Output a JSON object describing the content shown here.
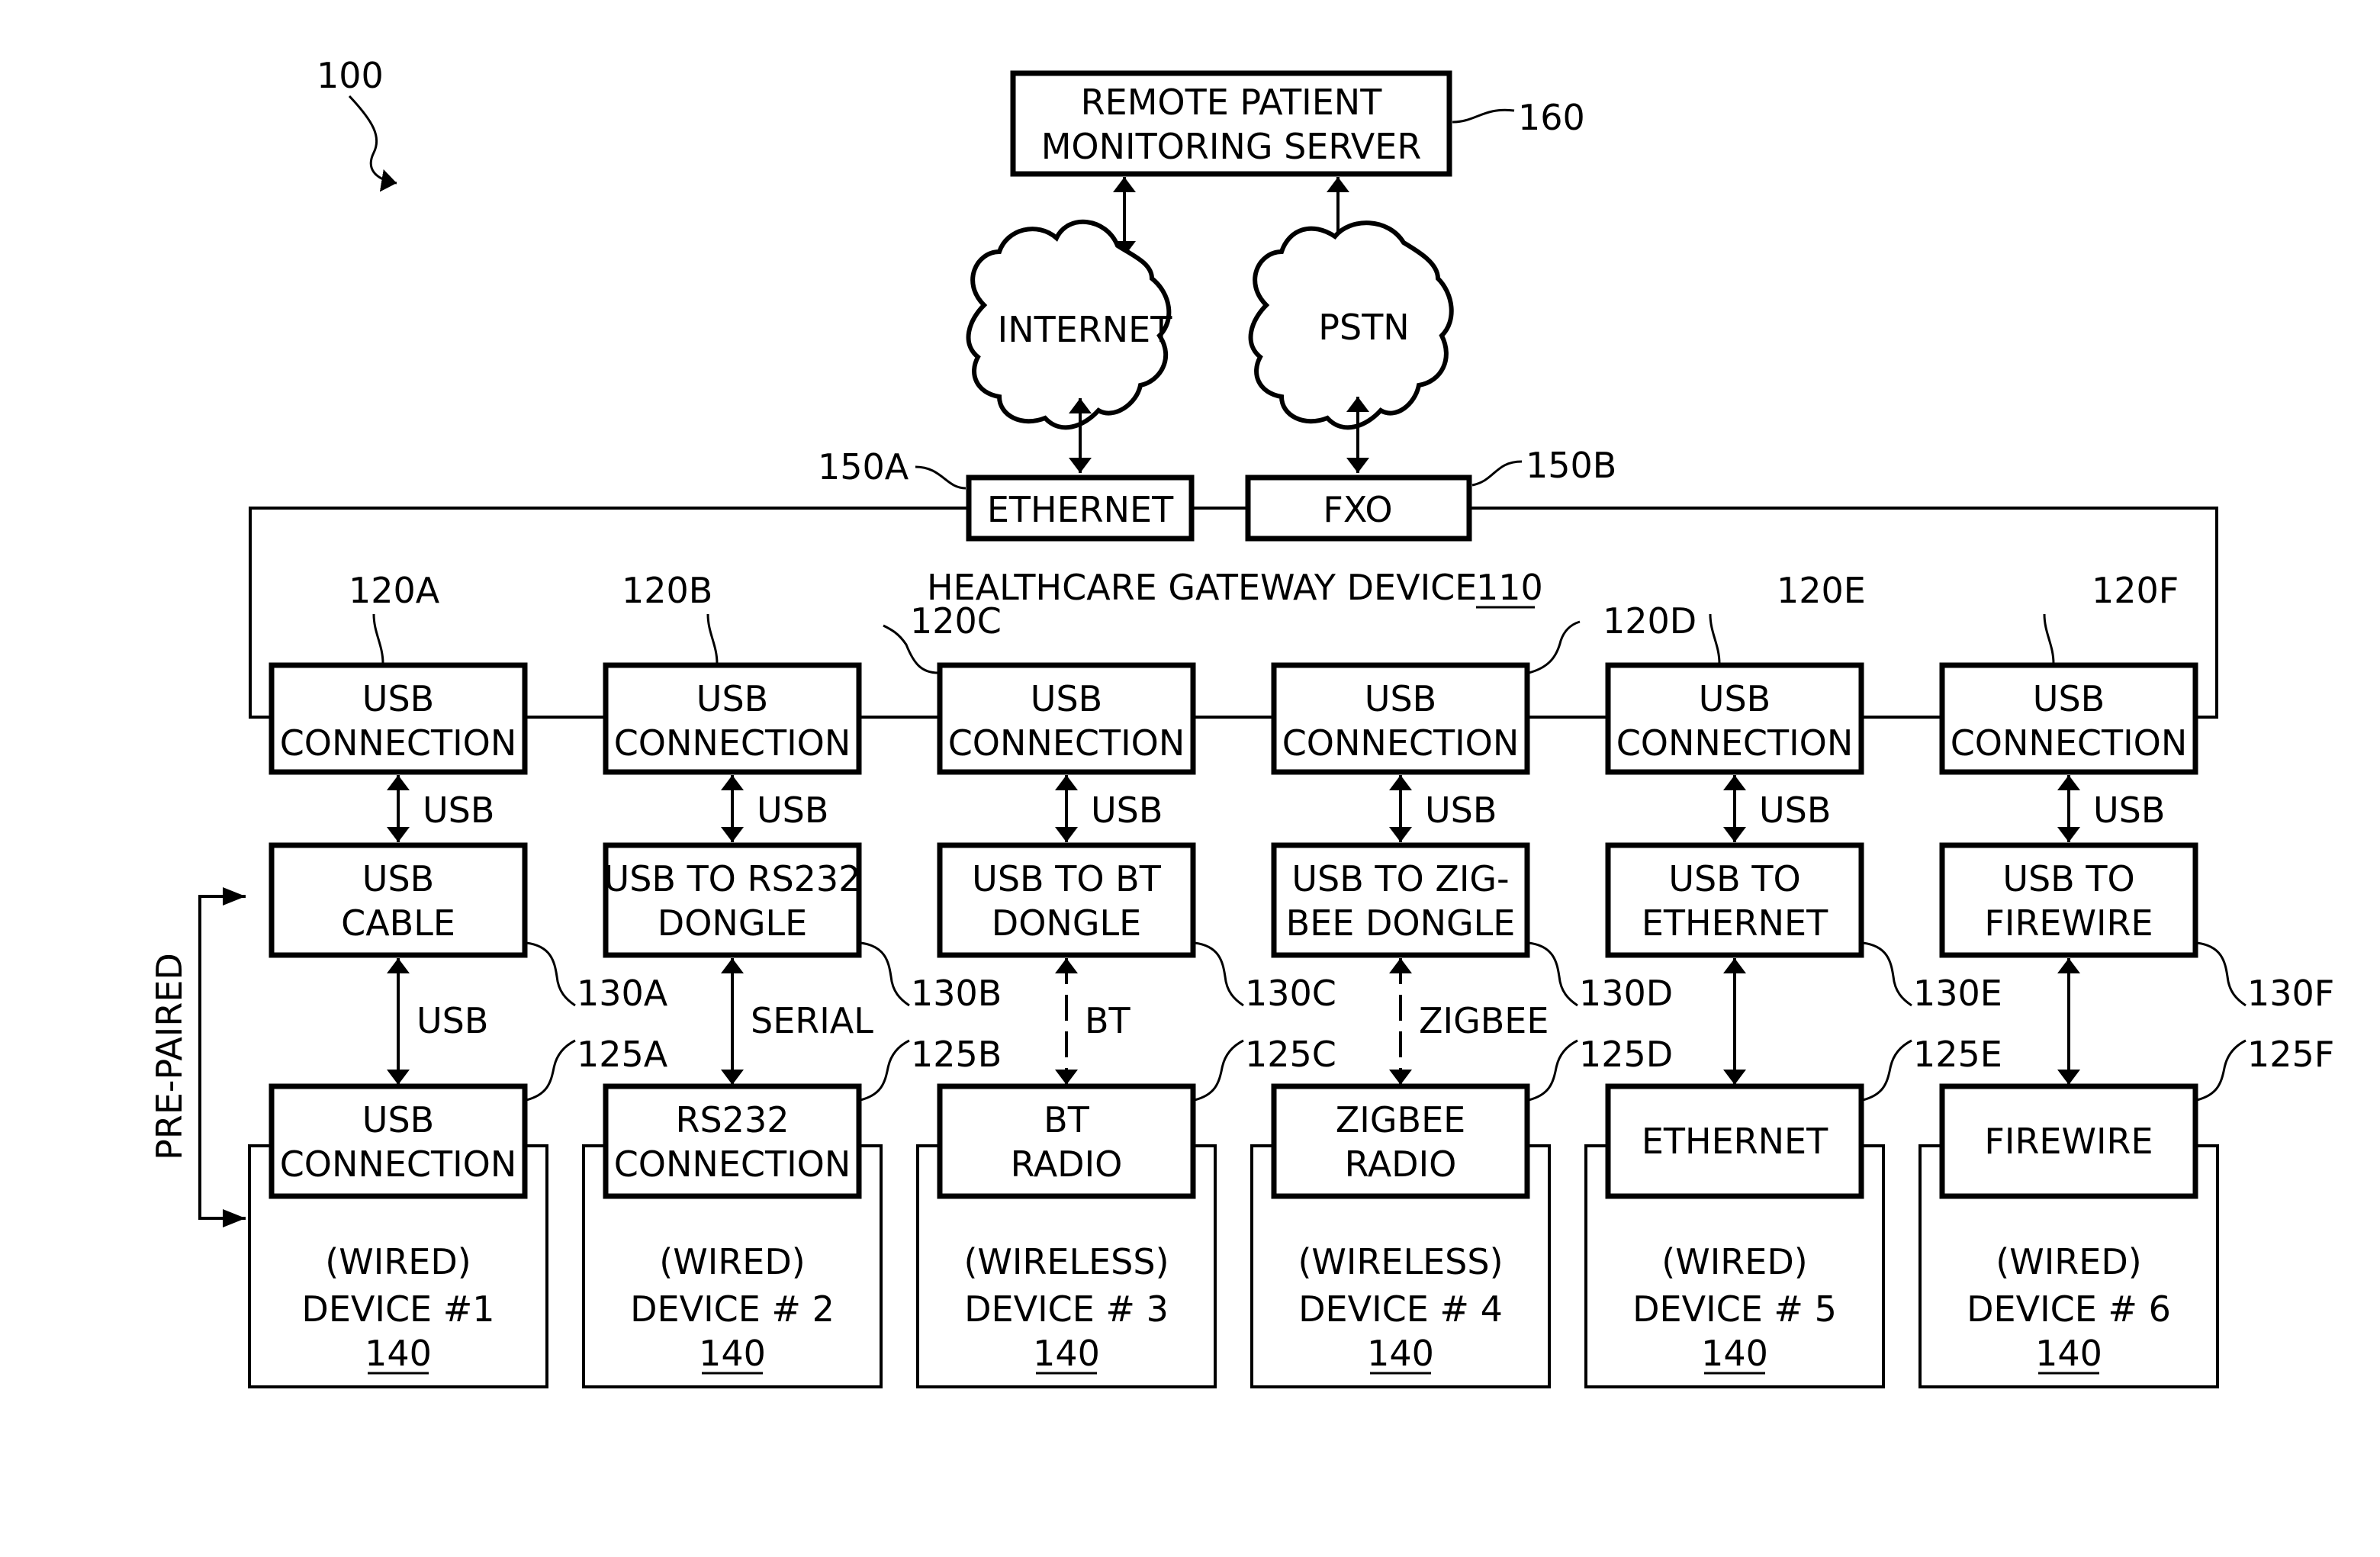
{
  "figure": {
    "ref": "100",
    "colors": {
      "line": "#000000",
      "background": "#ffffff"
    }
  },
  "server": {
    "lines": [
      "REMOTE PATIENT",
      "MONITORING SERVER"
    ],
    "ref": "160"
  },
  "networks": [
    {
      "label": "INTERNET"
    },
    {
      "label": "PSTN"
    }
  ],
  "uplinks": [
    {
      "label": "ETHERNET",
      "ref": "150A"
    },
    {
      "label": "FXO",
      "ref": "150B"
    }
  ],
  "gateway": {
    "title": "HEALTHCARE GATEWAY DEVICE",
    "ref": "110"
  },
  "pre_paired_label": "PRE-PAIRED",
  "columns": [
    {
      "usb_conn": {
        "lines": [
          "USB",
          "CONNECTION"
        ],
        "ref": "120A"
      },
      "usb_link": "USB",
      "adapter": {
        "lines": [
          "USB",
          "CABLE"
        ],
        "ref": "130A"
      },
      "device_link": {
        "label": "USB",
        "style": "solid"
      },
      "device_conn": {
        "lines": [
          "USB",
          "CONNECTION"
        ],
        "ref": "125A"
      },
      "device": {
        "type": "(WIRED)",
        "name": "DEVICE #1",
        "ref": "140"
      }
    },
    {
      "usb_conn": {
        "lines": [
          "USB",
          "CONNECTION"
        ],
        "ref": "120B"
      },
      "usb_link": "USB",
      "adapter": {
        "lines": [
          "USB TO RS232",
          "DONGLE"
        ],
        "ref": "130B"
      },
      "device_link": {
        "label": "SERIAL",
        "style": "solid"
      },
      "device_conn": {
        "lines": [
          "RS232",
          "CONNECTION"
        ],
        "ref": "125B"
      },
      "device": {
        "type": "(WIRED)",
        "name": "DEVICE # 2",
        "ref": "140"
      }
    },
    {
      "usb_conn": {
        "lines": [
          "USB",
          "CONNECTION"
        ],
        "ref": "120C"
      },
      "usb_link": "USB",
      "adapter": {
        "lines": [
          "USB TO BT",
          "DONGLE"
        ],
        "ref": "130C"
      },
      "device_link": {
        "label": "BT",
        "style": "dashed"
      },
      "device_conn": {
        "lines": [
          "BT",
          "RADIO"
        ],
        "ref": "125C"
      },
      "device": {
        "type": "(WIRELESS)",
        "name": "DEVICE # 3",
        "ref": "140"
      }
    },
    {
      "usb_conn": {
        "lines": [
          "USB",
          "CONNECTION"
        ],
        "ref": "120D"
      },
      "usb_link": "USB",
      "adapter": {
        "lines": [
          "USB TO ZIG-",
          "BEE DONGLE"
        ],
        "ref": "130D"
      },
      "device_link": {
        "label": "ZIGBEE",
        "style": "dashed"
      },
      "device_conn": {
        "lines": [
          "ZIGBEE",
          "RADIO"
        ],
        "ref": "125D"
      },
      "device": {
        "type": "(WIRELESS)",
        "name": "DEVICE # 4",
        "ref": "140"
      }
    },
    {
      "usb_conn": {
        "lines": [
          "USB",
          "CONNECTION"
        ],
        "ref": "120E"
      },
      "usb_link": "USB",
      "adapter": {
        "lines": [
          "USB TO",
          "ETHERNET"
        ],
        "ref": "130E"
      },
      "device_link": {
        "label": "",
        "style": "solid"
      },
      "device_conn": {
        "lines": [
          "ETHERNET"
        ],
        "ref": "125E"
      },
      "device": {
        "type": "(WIRED)",
        "name": "DEVICE # 5",
        "ref": "140"
      }
    },
    {
      "usb_conn": {
        "lines": [
          "USB",
          "CONNECTION"
        ],
        "ref": "120F"
      },
      "usb_link": "USB",
      "adapter": {
        "lines": [
          "USB TO",
          "FIREWIRE"
        ],
        "ref": "130F"
      },
      "device_link": {
        "label": "",
        "style": "solid"
      },
      "device_conn": {
        "lines": [
          "FIREWIRE"
        ],
        "ref": "125F"
      },
      "device": {
        "type": "(WIRED)",
        "name": "DEVICE # 6",
        "ref": "140"
      }
    }
  ]
}
